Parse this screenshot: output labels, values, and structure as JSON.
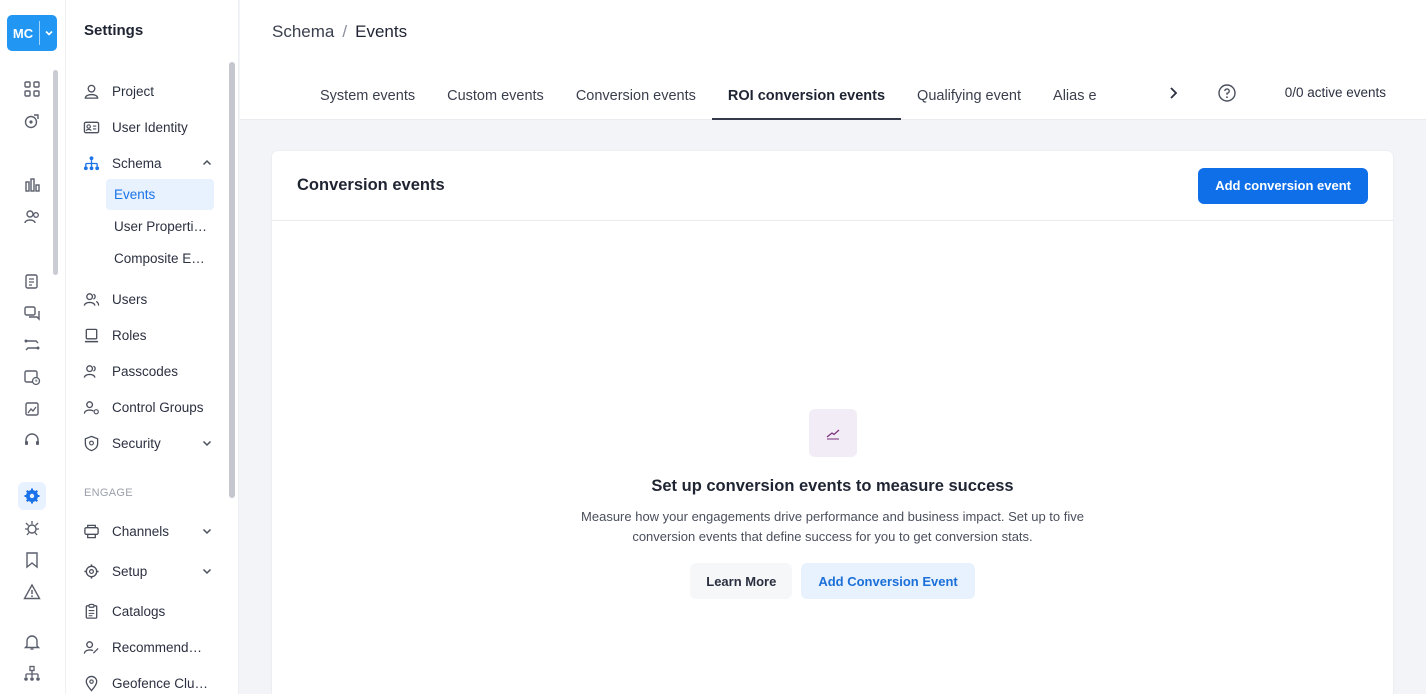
{
  "org": {
    "initials": "MC"
  },
  "rail": {
    "icons": [
      "dashboard-icon",
      "analytics-icon",
      "reports-icon",
      "segments-icon",
      "campaigns-icon",
      "messages-icon",
      "flows-icon",
      "schedule-icon",
      "content-icon",
      "support-icon",
      "settings-icon",
      "debug-icon",
      "bookmark-icon",
      "alert-icon",
      "notification-icon",
      "hierarchy-icon"
    ],
    "active": "settings-icon"
  },
  "sidebar": {
    "title": "Settings",
    "items": [
      {
        "label": "Project",
        "icon": "user-icon"
      },
      {
        "label": "User Identity",
        "icon": "id-card-icon"
      },
      {
        "label": "Schema",
        "icon": "schema-icon",
        "expanded": true
      },
      {
        "label": "Users",
        "icon": "users-icon"
      },
      {
        "label": "Roles",
        "icon": "roles-icon"
      },
      {
        "label": "Passcodes",
        "icon": "passcodes-icon"
      },
      {
        "label": "Control Groups",
        "icon": "control-groups-icon"
      },
      {
        "label": "Security",
        "icon": "shield-icon"
      }
    ],
    "schema_children": [
      {
        "label": "Events",
        "active": true
      },
      {
        "label": "User Properti…"
      },
      {
        "label": "Composite E…"
      }
    ],
    "section_label": "ENGAGE",
    "engage_items": [
      {
        "label": "Channels",
        "icon": "channels-icon"
      },
      {
        "label": "Setup",
        "icon": "gear-icon"
      },
      {
        "label": "Catalogs",
        "icon": "catalog-icon"
      },
      {
        "label": "Recommend…",
        "icon": "recommend-icon"
      },
      {
        "label": "Geofence Clu…",
        "icon": "location-pin-icon"
      }
    ]
  },
  "header": {
    "breadcrumb": {
      "parent": "Schema",
      "separator": "/",
      "current": "Events"
    },
    "tabs": [
      "System events",
      "Custom events",
      "Conversion events",
      "ROI conversion events",
      "Qualifying event",
      "Alias e"
    ],
    "active_tab": "ROI conversion events",
    "active_count": "0/0 active events"
  },
  "card": {
    "title": "Conversion events",
    "primary_button": "Add conversion event",
    "empty": {
      "title": "Set up conversion events to measure success",
      "description": "Measure how your engagements drive performance and business impact. Set up to five conversion events that define success for you to get conversion stats.",
      "learn_more": "Learn More",
      "add_button": "Add Conversion Event"
    }
  },
  "colors": {
    "accent": "#0f6fe8",
    "org_badge": "#2196f3",
    "active_bg": "#e8f1fe"
  }
}
